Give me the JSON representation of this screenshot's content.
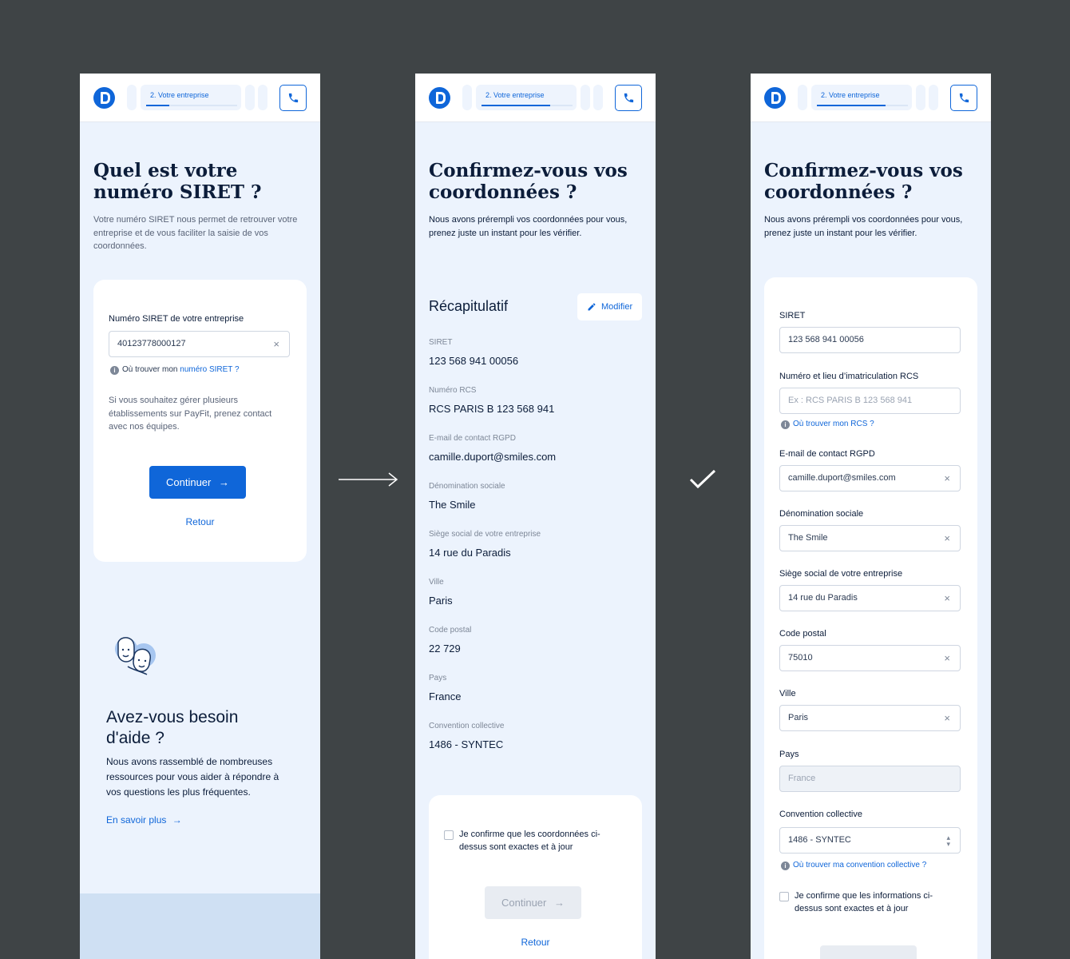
{
  "header": {
    "step_label": "2.  Votre entreprise",
    "step_progress_screen1": 0.25,
    "step_progress_screen2": 0.75,
    "step_progress_screen3": 0.75,
    "logo_icon": "payfit-logo-icon",
    "phone_icon": "phone-icon"
  },
  "screen1": {
    "title": "Quel est votre numéro SIRET  ?",
    "intro": "Votre numéro SIRET nous permet de retrouver votre entreprise et de vous faciliter la saisie de vos coordonnées.",
    "siret_label": "Numéro SIRET de votre entreprise",
    "siret_value": "40123778000127",
    "help_prefix": "Où trouver mon ",
    "help_link": "numéro SIRET ?",
    "multi_text": "Si vous souhaitez gérer plusieurs établissements sur PayFit, prenez contact avec nos équipes.",
    "continue_label": "Continuer",
    "back_label": "Retour",
    "help_title": "Avez-vous besoin d'aide ?",
    "help_text": "Nous avons rassemblé de nombreuses ressources pour vous aider à répondre à vos questions les plus fréquentes.",
    "help_link_label": "En savoir plus"
  },
  "screen2": {
    "title": "Confirmez-vous vos coordonnées ?",
    "intro": "Nous avons prérempli vos coordonnées pour vous, prenez juste un instant pour les vérifier.",
    "recap_title": "Récapitulatif",
    "modify_label": "Modifier",
    "items": [
      {
        "label": "SIRET",
        "value": "123 568 941 00056"
      },
      {
        "label": "Numéro RCS",
        "value": "RCS PARIS B 123 568 941"
      },
      {
        "label": "E-mail de contact RGPD",
        "value": "camille.duport@smiles.com"
      },
      {
        "label": "Dénomination sociale",
        "value": "The Smile"
      },
      {
        "label": "Siège social de votre entreprise",
        "value": "14 rue du Paradis"
      },
      {
        "label": "Ville",
        "value": "Paris"
      },
      {
        "label": "Code postal",
        "value": "22 729"
      },
      {
        "label": "Pays",
        "value": "France"
      },
      {
        "label": "Convention collective",
        "value": "1486 - SYNTEC"
      }
    ],
    "confirm_text": "Je confirme que les coordonnées ci-dessus sont exactes et à jour",
    "continue_label": "Continuer",
    "back_label": "Retour"
  },
  "screen3": {
    "title": "Confirmez-vous vos coordonnées ?",
    "intro": "Nous avons prérempli vos coordonnées pour vous, prenez juste un instant pour les vérifier.",
    "siret_label": "SIRET",
    "siret_value": "123 568 941 00056",
    "rcs_label": "Numéro et lieu d’imatriculation RCS",
    "rcs_placeholder": "Ex : RCS PARIS B 123 568 941",
    "rcs_help": "Où trouver mon RCS ?",
    "email_label": "E-mail de contact RGPD",
    "email_value": "camille.duport@smiles.com",
    "denomination_label": "Dénomination sociale",
    "denomination_value": "The Smile",
    "siege_label": "Siège social de votre entreprise",
    "siege_value": "14 rue du Paradis",
    "postal_label": "Code postal",
    "postal_value": "75010",
    "ville_label": "Ville",
    "ville_value": "Paris",
    "pays_label": "Pays",
    "pays_value": "France",
    "convention_label": "Convention collective",
    "convention_value": "1486 - SYNTEC",
    "convention_help": "Où trouver ma convention collective ?",
    "confirm_text": "Je confirme que les informations ci-dessus sont exactes et à jour"
  },
  "clear_icon": "×",
  "colors": {
    "background": "#3f4446",
    "screen": "#ecf3fd",
    "primary": "#0f66d9",
    "text": "#0c1d3a"
  }
}
